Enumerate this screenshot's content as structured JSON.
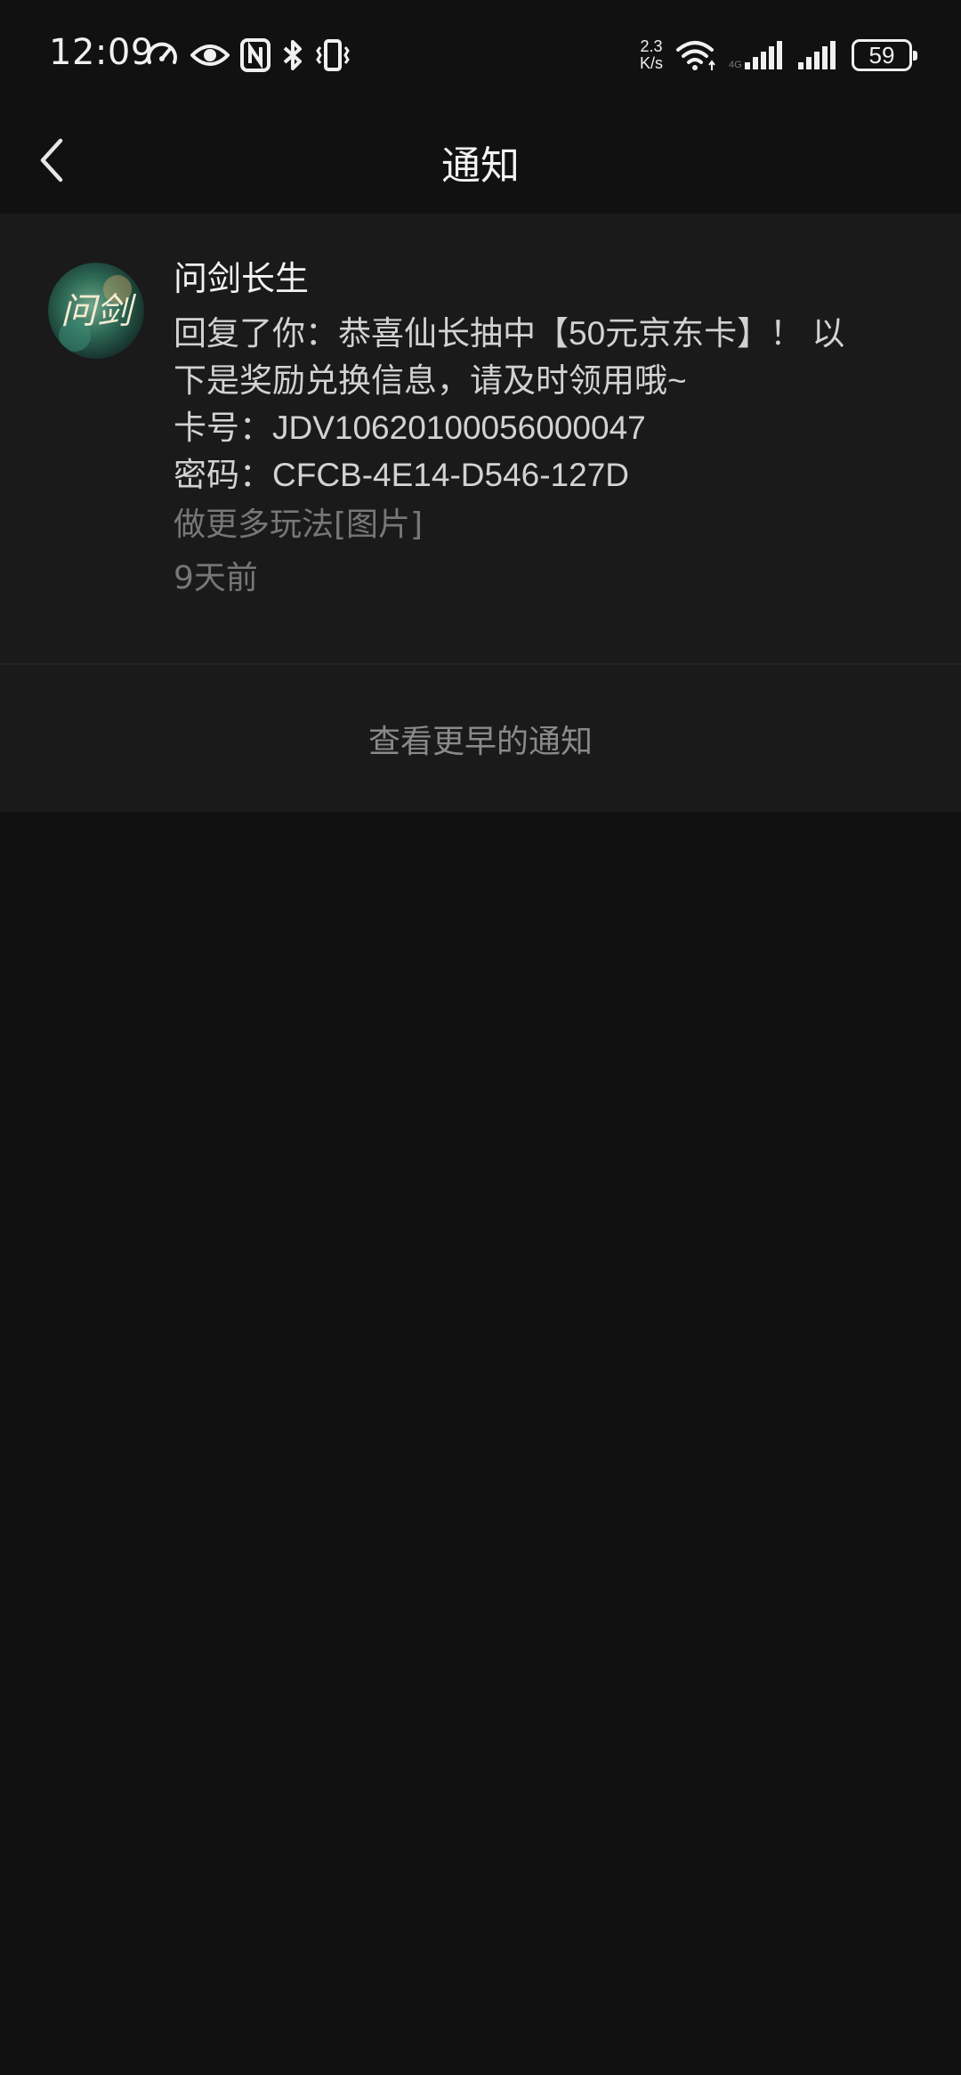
{
  "status_bar": {
    "time": "12:09",
    "net_speed_value": "2.3",
    "net_speed_unit": "K/s",
    "battery": "59",
    "icons": [
      "speedometer-icon",
      "eye-icon",
      "nfc-icon",
      "bluetooth-icon",
      "vibrate-icon",
      "wifi-icon",
      "signal-icon",
      "signal-icon"
    ]
  },
  "nav": {
    "title": "通知",
    "back_icon": "chevron-left-icon"
  },
  "notification": {
    "sender": "问剑长生",
    "lines": [
      "回复了你：恭喜仙长抽中【50元京东卡】！ 以",
      "下是奖励兑换信息，请及时领用哦~",
      "卡号：JDV10620100056000047",
      "密码：CFCB-4E14-D546-127D"
    ],
    "reply_context": "做更多玩法[图片]",
    "time_ago": "9天前",
    "avatar_text": "问剑"
  },
  "earlier": {
    "label": "查看更早的通知"
  },
  "colors": {
    "background": "#111111",
    "card": "#1a1a1a",
    "text_primary": "#f2f2f2",
    "text_secondary": "#d2d2d2",
    "text_muted": "#777777"
  }
}
